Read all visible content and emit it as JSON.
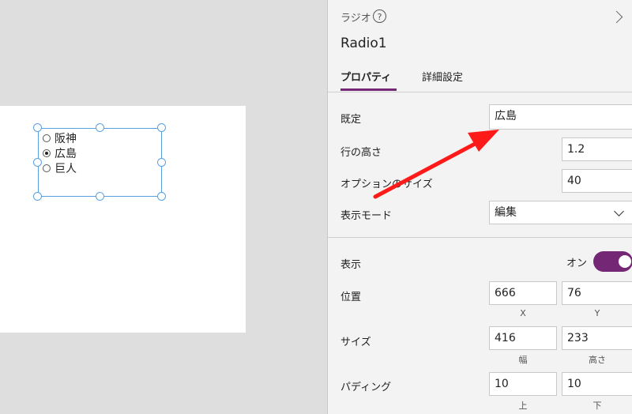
{
  "canvas": {
    "radio_options": [
      {
        "label": "阪神",
        "selected": false
      },
      {
        "label": "広島",
        "selected": true
      },
      {
        "label": "巨人",
        "selected": false
      }
    ]
  },
  "panel": {
    "control_type": "ラジオ",
    "help_icon": "?",
    "control_name": "Radio1",
    "tabs": [
      {
        "label": "プロパティ",
        "active": true
      },
      {
        "label": "詳細設定",
        "active": false
      }
    ],
    "properties": {
      "default_label": "既定",
      "default_value": "広島",
      "line_height_label": "行の高さ",
      "line_height_value": "1.2",
      "option_size_label": "オプションのサイズ",
      "option_size_value": "40",
      "display_mode_label": "表示モード",
      "display_mode_value": "編集",
      "visible_label": "表示",
      "visible_state": "オン",
      "position_label": "位置",
      "position_x": "666",
      "position_y": "76",
      "x_label": "X",
      "y_label": "Y",
      "size_label": "サイズ",
      "width_value": "416",
      "height_value": "233",
      "width_label": "幅",
      "height_label": "高さ",
      "padding_label": "パディング",
      "padding_top": "10",
      "padding_bottom": "10",
      "top_label": "上",
      "bottom_label": "下"
    }
  },
  "colors": {
    "accent": "#742774",
    "selection": "#5aa0e0",
    "annotation_arrow": "#ff1a1a"
  }
}
